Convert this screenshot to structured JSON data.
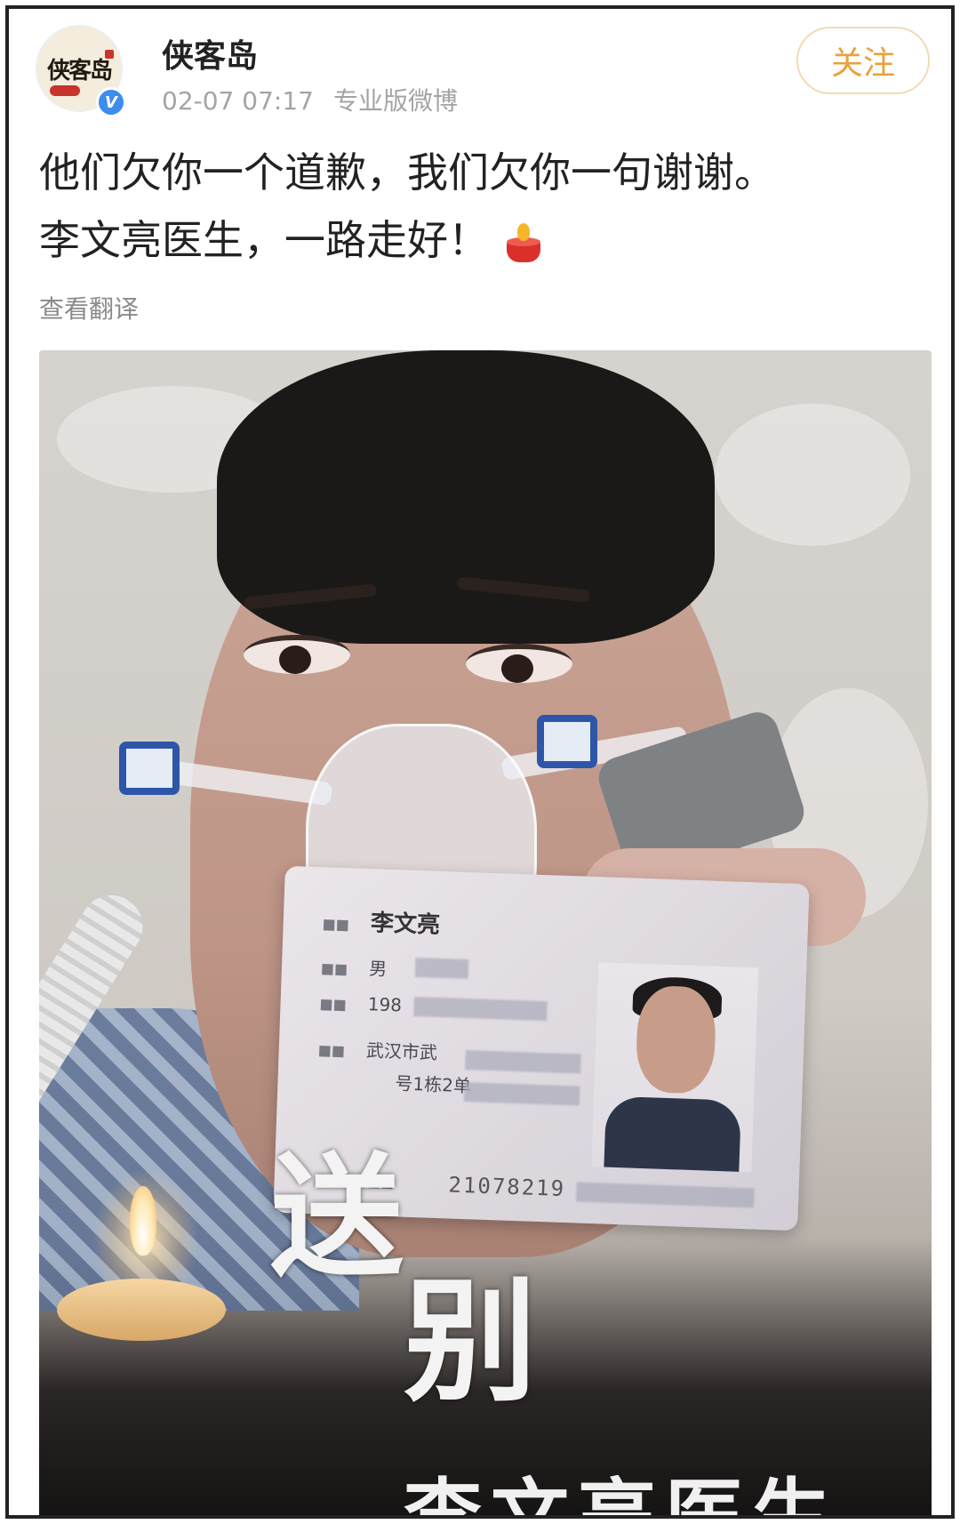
{
  "account": {
    "avatar_text": "侠客岛",
    "verified_mark": "V",
    "name": "侠客岛",
    "timestamp": "02-07 07:17",
    "source": "专业版微博"
  },
  "follow_label": "关注",
  "post": {
    "line1": "他们欠你一个道歉，我们欠你一句谢谢。",
    "line2": "李文亮医生，一路走好！",
    "emoji": "candle-icon"
  },
  "translate_label": "查看翻译",
  "image": {
    "id_card": {
      "name": "李文亮",
      "sex_value": "男",
      "birth_partial": "198",
      "address_partial": "武汉市武",
      "address_line2_partial": "号1栋2单",
      "number_partial": "21078219"
    },
    "farewell_line1": "送",
    "farewell_line2": "别",
    "farewell_name": "李文亮医生"
  },
  "colors": {
    "follow_text": "#e8a23c",
    "verified_badge": "#3d8cf0",
    "meta_text": "#a4a4a4"
  }
}
